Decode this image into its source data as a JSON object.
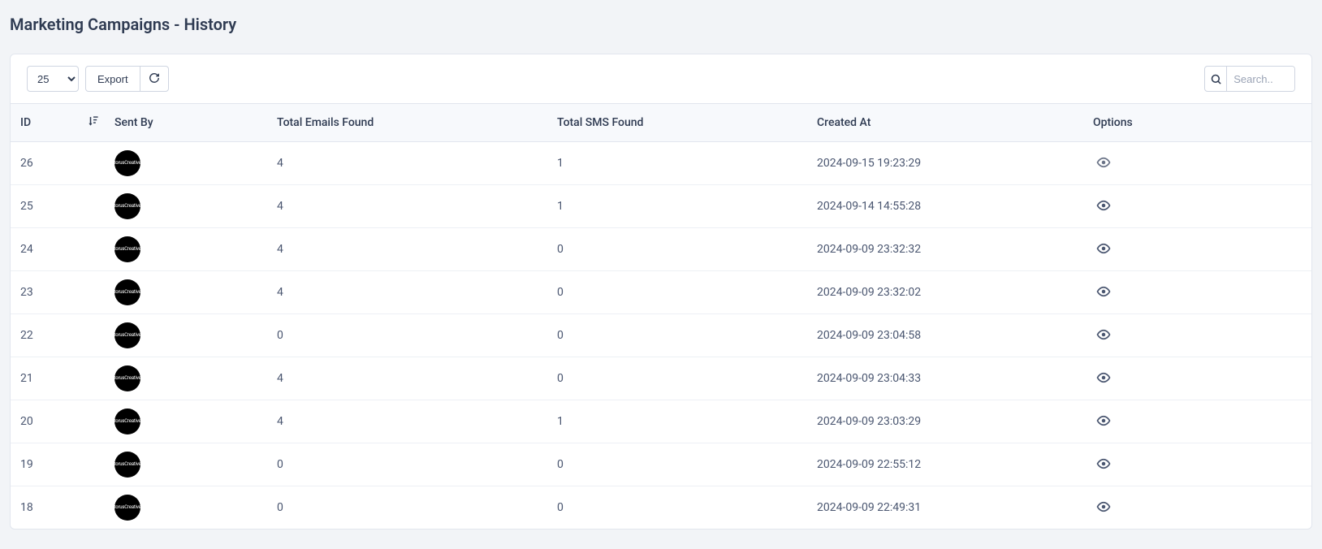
{
  "page": {
    "title": "Marketing Campaigns - History"
  },
  "toolbar": {
    "page_size_selected": "25",
    "page_size_options": [
      "25"
    ],
    "export_label": "Export",
    "refresh_title": "Refresh",
    "search_placeholder": "Search.."
  },
  "columns": {
    "id": "ID",
    "sent_by": "Sent By",
    "emails": "Total Emails Found",
    "sms": "Total SMS Found",
    "created": "Created At",
    "options": "Options"
  },
  "avatar_label": "torusCreative",
  "rows": [
    {
      "id": "26",
      "emails": "4",
      "sms": "1",
      "created": "2024-09-15 19:23:29"
    },
    {
      "id": "25",
      "emails": "4",
      "sms": "1",
      "created": "2024-09-14 14:55:28"
    },
    {
      "id": "24",
      "emails": "4",
      "sms": "0",
      "created": "2024-09-09 23:32:32"
    },
    {
      "id": "23",
      "emails": "4",
      "sms": "0",
      "created": "2024-09-09 23:32:02"
    },
    {
      "id": "22",
      "emails": "0",
      "sms": "0",
      "created": "2024-09-09 23:04:58"
    },
    {
      "id": "21",
      "emails": "4",
      "sms": "0",
      "created": "2024-09-09 23:04:33"
    },
    {
      "id": "20",
      "emails": "4",
      "sms": "1",
      "created": "2024-09-09 23:03:29"
    },
    {
      "id": "19",
      "emails": "0",
      "sms": "0",
      "created": "2024-09-09 22:55:12"
    },
    {
      "id": "18",
      "emails": "0",
      "sms": "0",
      "created": "2024-09-09 22:49:31"
    }
  ]
}
